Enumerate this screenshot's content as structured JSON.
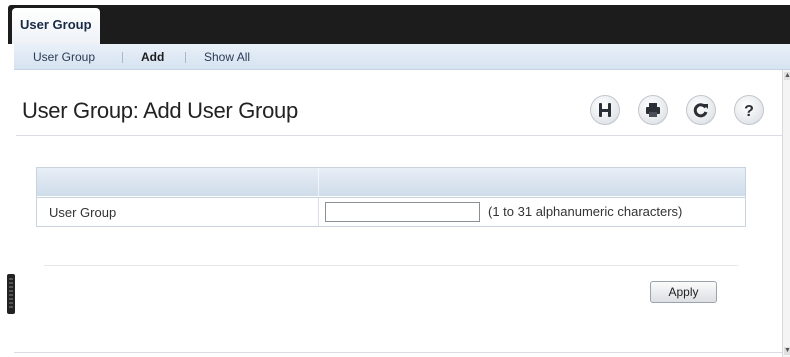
{
  "top_tab": {
    "label": "User Group"
  },
  "subnav": {
    "items": [
      {
        "label": "User Group"
      },
      {
        "label": "Add"
      },
      {
        "label": "Show All"
      }
    ],
    "active_index": 1
  },
  "page": {
    "title": "User Group: Add User Group"
  },
  "toolbar": {
    "buttons": [
      {
        "icon": "save-icon"
      },
      {
        "icon": "print-icon"
      },
      {
        "icon": "refresh-icon"
      },
      {
        "icon": "help-icon"
      }
    ]
  },
  "form": {
    "rows": [
      {
        "label": "User Group",
        "value": "",
        "hint": "(1 to 31 alphanumeric characters)"
      }
    ]
  },
  "actions": {
    "apply_label": "Apply"
  },
  "colors": {
    "topbar": "#1c1c1c",
    "subnav_bg": "#dfe8f3",
    "table_header": "#d7e2ee",
    "accent_text": "#1a2a45"
  }
}
